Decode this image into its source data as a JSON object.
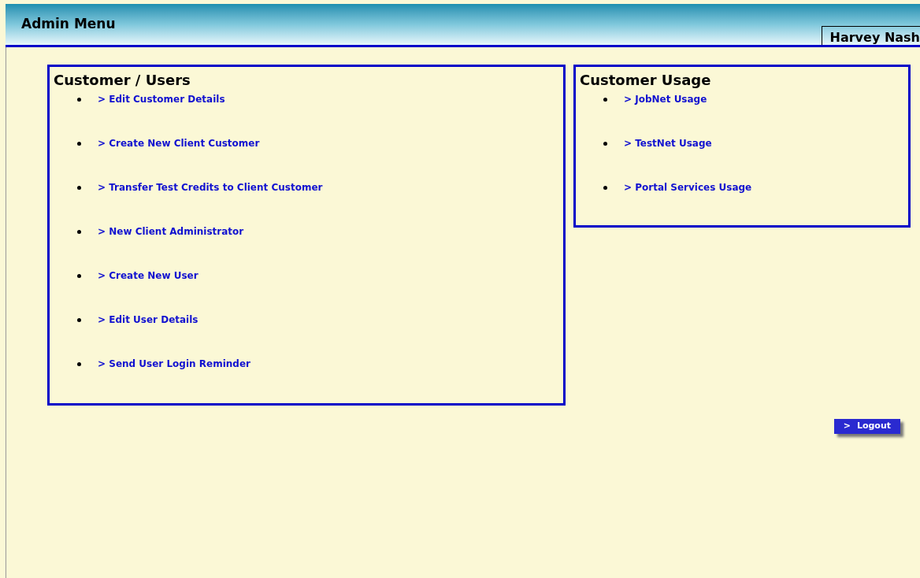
{
  "header": {
    "title": "Admin Menu",
    "brand": "Harvey Nash"
  },
  "panels": [
    {
      "title": "Customer / Users",
      "links": [
        "> Edit Customer Details",
        "> Create New Client Customer",
        "> Transfer Test Credits to Client Customer",
        "> New Client Administrator",
        "> Create New User",
        "> Edit User Details",
        "> Send User Login Reminder"
      ]
    },
    {
      "title": "Customer Usage",
      "links": [
        "> JobNet Usage",
        "> TestNet Usage",
        "> Portal Services Usage"
      ]
    }
  ],
  "logout": {
    "arrow": ">",
    "label": "Logout"
  }
}
